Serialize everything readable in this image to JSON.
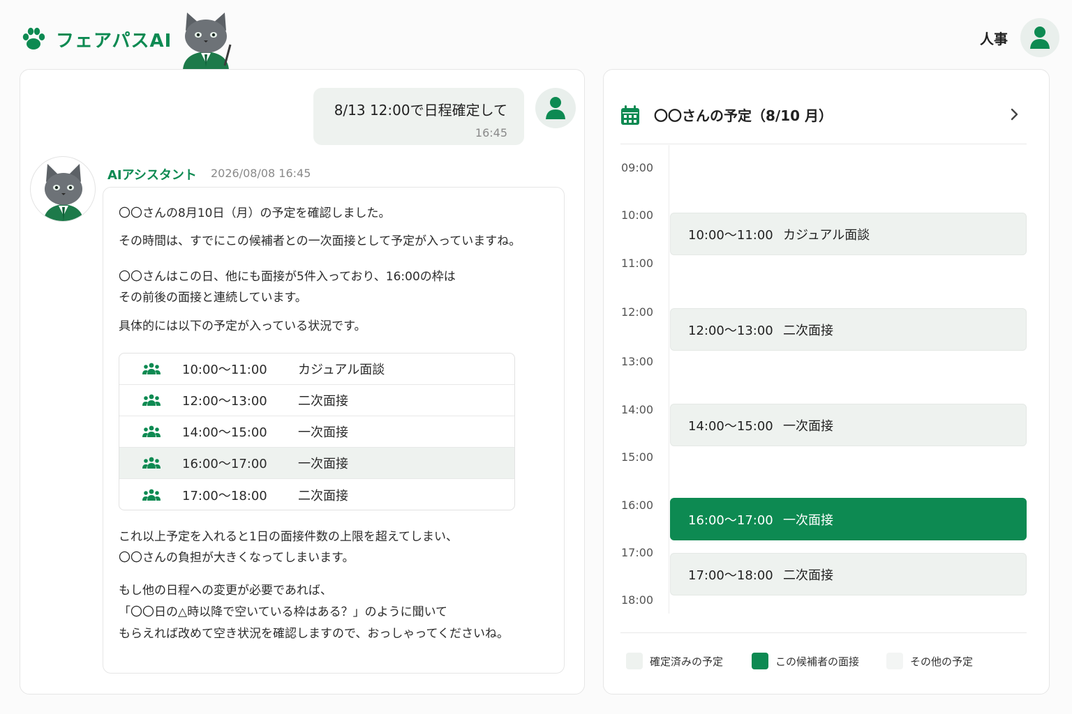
{
  "header": {
    "logo_text": "フェアパスAI",
    "user_role": "人事"
  },
  "chat": {
    "user_message": "8/13 12:00で日程確定して",
    "user_time": "16:45",
    "assistant_name": "AIアシスタント",
    "assistant_timestamp": "2026/08/08 16:45",
    "paragraphs": [
      "〇〇さんの8月10日（月）の予定を確認しました。",
      "その時間は、すでにこの候補者との一次面接として予定が入っていますね。",
      "〇〇さんはこの日、他にも面接が5件入っており、16:00の枠は",
      "その前後の面接と連続しています。",
      "具体的には以下の予定が入っている状況です。",
      "これ以上予定を入れると1日の面接件数の上限を超えてしまい、",
      "〇〇さんの負担が大きくなってしまいます。",
      "もし他の日程への変更が必要であれば、",
      "「〇〇日の△時以降で空いている枠はある？」のように聞いて",
      "もらえれば改めて空き状況を確認しますので、おっしゃってくださいね。"
    ],
    "schedule": [
      {
        "time": "10:00〜11:00",
        "title": "カジュアル面談",
        "highlight": false
      },
      {
        "time": "12:00〜13:00",
        "title": "二次面接",
        "highlight": false
      },
      {
        "time": "14:00〜15:00",
        "title": "一次面接",
        "highlight": false
      },
      {
        "time": "16:00〜17:00",
        "title": "一次面接",
        "highlight": true
      },
      {
        "time": "17:00〜18:00",
        "title": "二次面接",
        "highlight": false
      }
    ]
  },
  "calendar": {
    "title": "〇〇さんの予定（8/10 月）",
    "hours": [
      "09:00",
      "10:00",
      "11:00",
      "12:00",
      "13:00",
      "14:00",
      "15:00",
      "16:00",
      "17:00",
      "18:00"
    ],
    "events": [
      {
        "time": "10:00〜11:00",
        "title": "カジュアル面談",
        "type": "confirmed"
      },
      {
        "time": "12:00〜13:00",
        "title": "二次面接",
        "type": "confirmed"
      },
      {
        "time": "14:00〜15:00",
        "title": "一次面接",
        "type": "confirmed"
      },
      {
        "time": "16:00〜17:00",
        "title": "一次面接",
        "type": "candidate"
      },
      {
        "time": "17:00〜18:00",
        "title": "二次面接",
        "type": "confirmed"
      }
    ],
    "legend": [
      {
        "label": "確定済みの予定",
        "color": "#eef2ef"
      },
      {
        "label": "この候補者の面接",
        "color": "#0d8a52"
      },
      {
        "label": "その他の予定",
        "color": "#f3f5f4"
      }
    ]
  },
  "colors": {
    "accent": "#0d8a52",
    "soft": "#eef2ef"
  },
  "icons": [
    "paw-icon",
    "user-icon",
    "calendar-icon",
    "chevron-right-icon",
    "people-icon"
  ]
}
